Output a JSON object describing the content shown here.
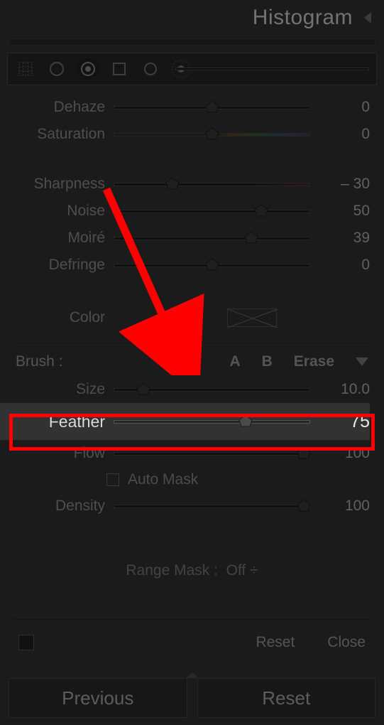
{
  "panel": {
    "title": "Histogram"
  },
  "adjustments": [
    {
      "name": "Dehaze",
      "value": "0",
      "pos": 50,
      "style": ""
    },
    {
      "name": "Saturation",
      "value": "0",
      "pos": 50,
      "style": "grad-sat"
    },
    {
      "name": "Sharpness",
      "value": "– 30",
      "pos": 30,
      "style": "grad-sharp"
    },
    {
      "name": "Noise",
      "value": "50",
      "pos": 75,
      "style": ""
    },
    {
      "name": "Moiré",
      "value": "39",
      "pos": 70,
      "style": ""
    },
    {
      "name": "Defringe",
      "value": "0",
      "pos": 50,
      "style": ""
    }
  ],
  "color_label": "Color",
  "brush": {
    "label": "Brush :",
    "opt_a": "A",
    "opt_b": "B",
    "opt_erase": "Erase",
    "settings": [
      {
        "name": "Size",
        "value": "10.0",
        "pos": 15
      },
      {
        "name": "Feather",
        "value": "75",
        "pos": 67
      },
      {
        "name": "Flow",
        "value": "100",
        "pos": 100
      },
      {
        "name": "Density",
        "value": "100",
        "pos": 100
      }
    ],
    "automask": "Auto Mask"
  },
  "range_mask": {
    "label": "Range Mask :",
    "value": "Off"
  },
  "buttons": {
    "reset": "Reset",
    "close": "Close",
    "previous": "Previous",
    "reset_big": "Reset"
  }
}
